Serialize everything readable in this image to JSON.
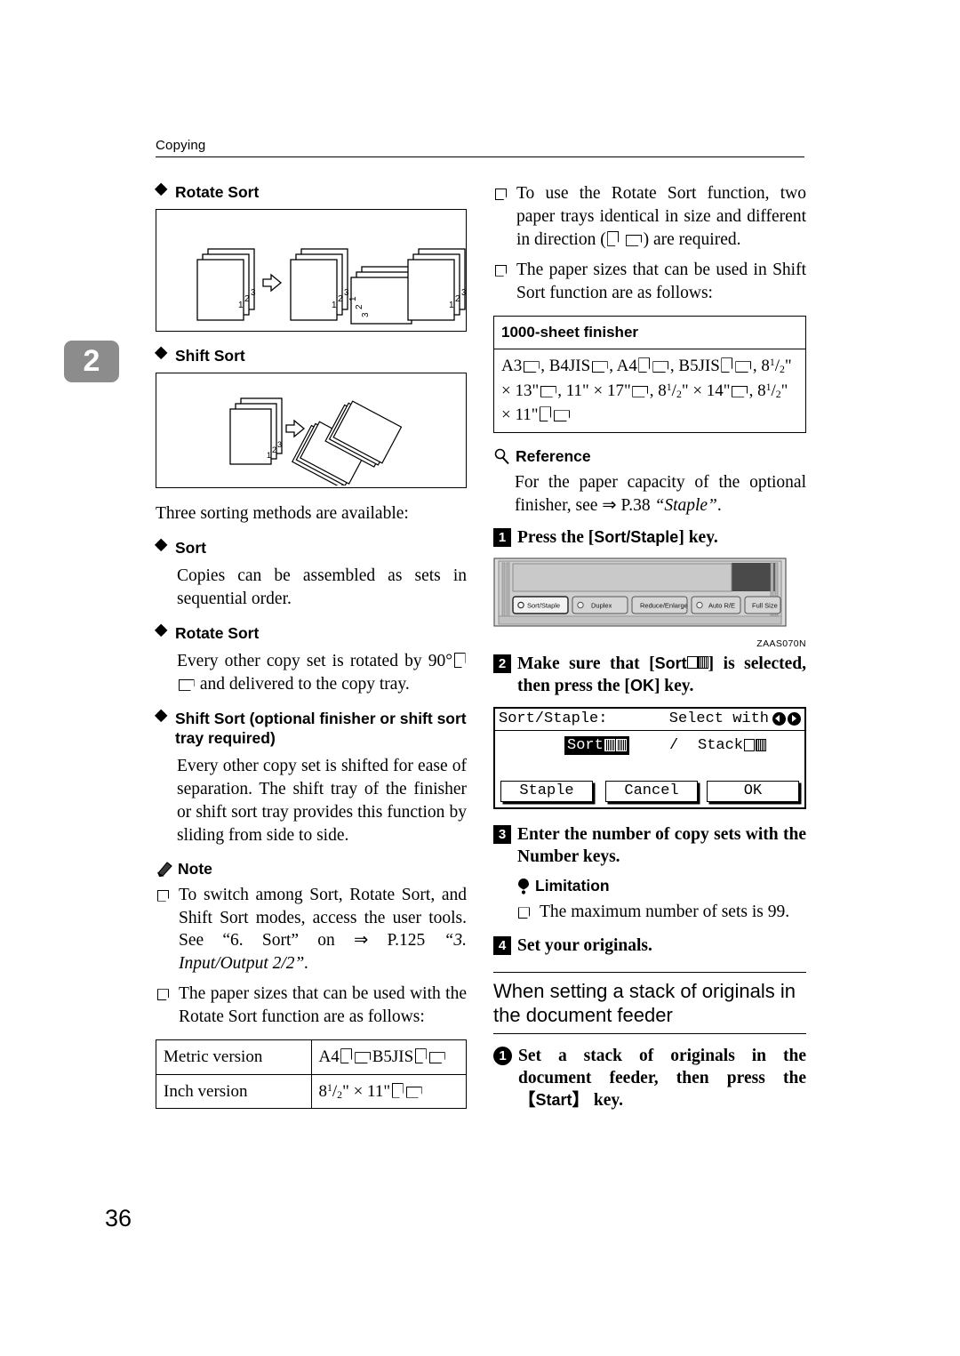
{
  "header": {
    "label": "Copying"
  },
  "chapter_tab": {
    "number": "2"
  },
  "page_number": "36",
  "left": {
    "heading_rotate_sort": "Rotate Sort",
    "heading_shift_sort": "Shift Sort",
    "intro": "Three sorting methods are available:",
    "sort": {
      "heading": "Sort",
      "body": "Copies can be assembled as sets in sequential order."
    },
    "rotate_sort": {
      "heading": "Rotate Sort",
      "body_pre": "Every other copy set is rotated by 90°",
      "body_post": "and delivered to the copy tray."
    },
    "shift_sort": {
      "heading": "Shift Sort (optional finisher or shift sort tray required)",
      "body": "Every other copy set is shifted for ease of separation. The shift tray of the finisher or shift sort tray provides this function by sliding from side to side."
    },
    "note": {
      "heading": "Note",
      "items": [
        "To switch among Sort, Rotate Sort, and Shift Sort modes, access the user tools. See “6. Sort” on ⇒ P.125 “3. Input/Output 2/2”.",
        "The paper sizes that can be used with the Rotate Sort function are as follows:"
      ],
      "item1_plain": "To switch among Sort, Rotate Sort, and Shift Sort modes, access the user tools. See “6. Sort” on ⇒ P.125 ",
      "item1_italic": "“3. Input/Output 2/2”.",
      "item2": "The paper sizes that can be used with the Rotate Sort function are as follows:"
    },
    "size_table": {
      "rows": [
        {
          "label": "Metric version",
          "value": "A4 □ □ B5JIS □ □"
        },
        {
          "label": "Inch version",
          "value": "8 1/2\" × 11\" □ □"
        }
      ],
      "metric_label": "Metric version",
      "metric_a4": "A4",
      "metric_b5": "B5JIS",
      "inch_label": "Inch version",
      "inch_whole": "8",
      "inch_num": "1",
      "inch_den": "2",
      "inch_rest": "\" × 11\""
    }
  },
  "right": {
    "notes": {
      "item1_pre": "To use the Rotate Sort function, two paper trays identical in size and different in direction (",
      "item1_post": ") are required.",
      "item2": "The paper sizes that can be used in Shift Sort function are as follows:"
    },
    "finisher_table": {
      "header": "1000-sheet finisher",
      "sizes_text": "A3□, B4JIS□, A4□□, B5JIS□□, 8 1/2\" × 13\"□, 11\" × 17\"□, 8 1/2\" × 14\"□, 8 1/2\" × 11\"□□",
      "t_a3": "A3",
      "t_b4": ", B4JIS",
      "t_a4": ", A4",
      "t_b5": ", B5JIS",
      "t_8": ", 8",
      "t_n1": "1",
      "t_d1": "2",
      "t_13": "\" × 13\"",
      "t_1117": ", 11\" × 17\"",
      "t_82": ", 8",
      "t_n2": "1",
      "t_d2": "2",
      "t_14": "\" × 14\"",
      "t_83": ", 8",
      "t_n3": "1",
      "t_d3": "2",
      "t_11": "\" × 11\""
    },
    "reference": {
      "heading": "Reference",
      "body_pre": "For the paper capacity of the optional finisher, see ⇒ P.38 ",
      "body_italic": "“Staple”",
      "body_post": "."
    },
    "steps": {
      "s1_num": "1",
      "s1_pre": "Press the [",
      "s1_key": "Sort/Staple",
      "s1_post": "] key.",
      "s2_num": "2",
      "s2_a": "Make sure that [",
      "s2_key": "Sort",
      "s2_b": "] is selected, then press the [",
      "s2_key2": "OK",
      "s2_c": "] key.",
      "s3_num": "3",
      "s3_text": "Enter the number of copy sets with the Number keys.",
      "s4_num": "4",
      "s4_text": "Set your originals."
    },
    "limitation": {
      "heading": "Limitation",
      "item": "The maximum number of sets is 99."
    },
    "control_panel": {
      "caption": "ZAAS070N",
      "buttons": [
        {
          "label": "Sort/Staple",
          "has_led": true,
          "selected": true
        },
        {
          "label": "Duplex",
          "has_led": true,
          "selected": false
        },
        {
          "label": "Reduce/Enlarge",
          "has_led": false,
          "selected": false
        },
        {
          "label": "Auto R/E",
          "has_led": true,
          "selected": false
        },
        {
          "label": "Full Size",
          "has_led": false,
          "selected": false
        }
      ]
    },
    "lcd": {
      "title": "Sort/Staple:",
      "select_with": "Select with",
      "sort_label": "Sort",
      "separator": "/",
      "stack_label": "Stack",
      "btn_staple": "Staple",
      "btn_cancel": "Cancel",
      "btn_ok": "OK"
    },
    "subsection": {
      "title": "When setting a stack of originals in the document feeder",
      "step_num": "1",
      "step_pre": "Set a stack of originals in the document feeder, then press the 【",
      "step_key": "Start",
      "step_post": "】 key."
    }
  },
  "colors": {
    "chapter_tab_bg": "#8c8c8c",
    "ink": "#000000",
    "paper": "#ffffff"
  }
}
